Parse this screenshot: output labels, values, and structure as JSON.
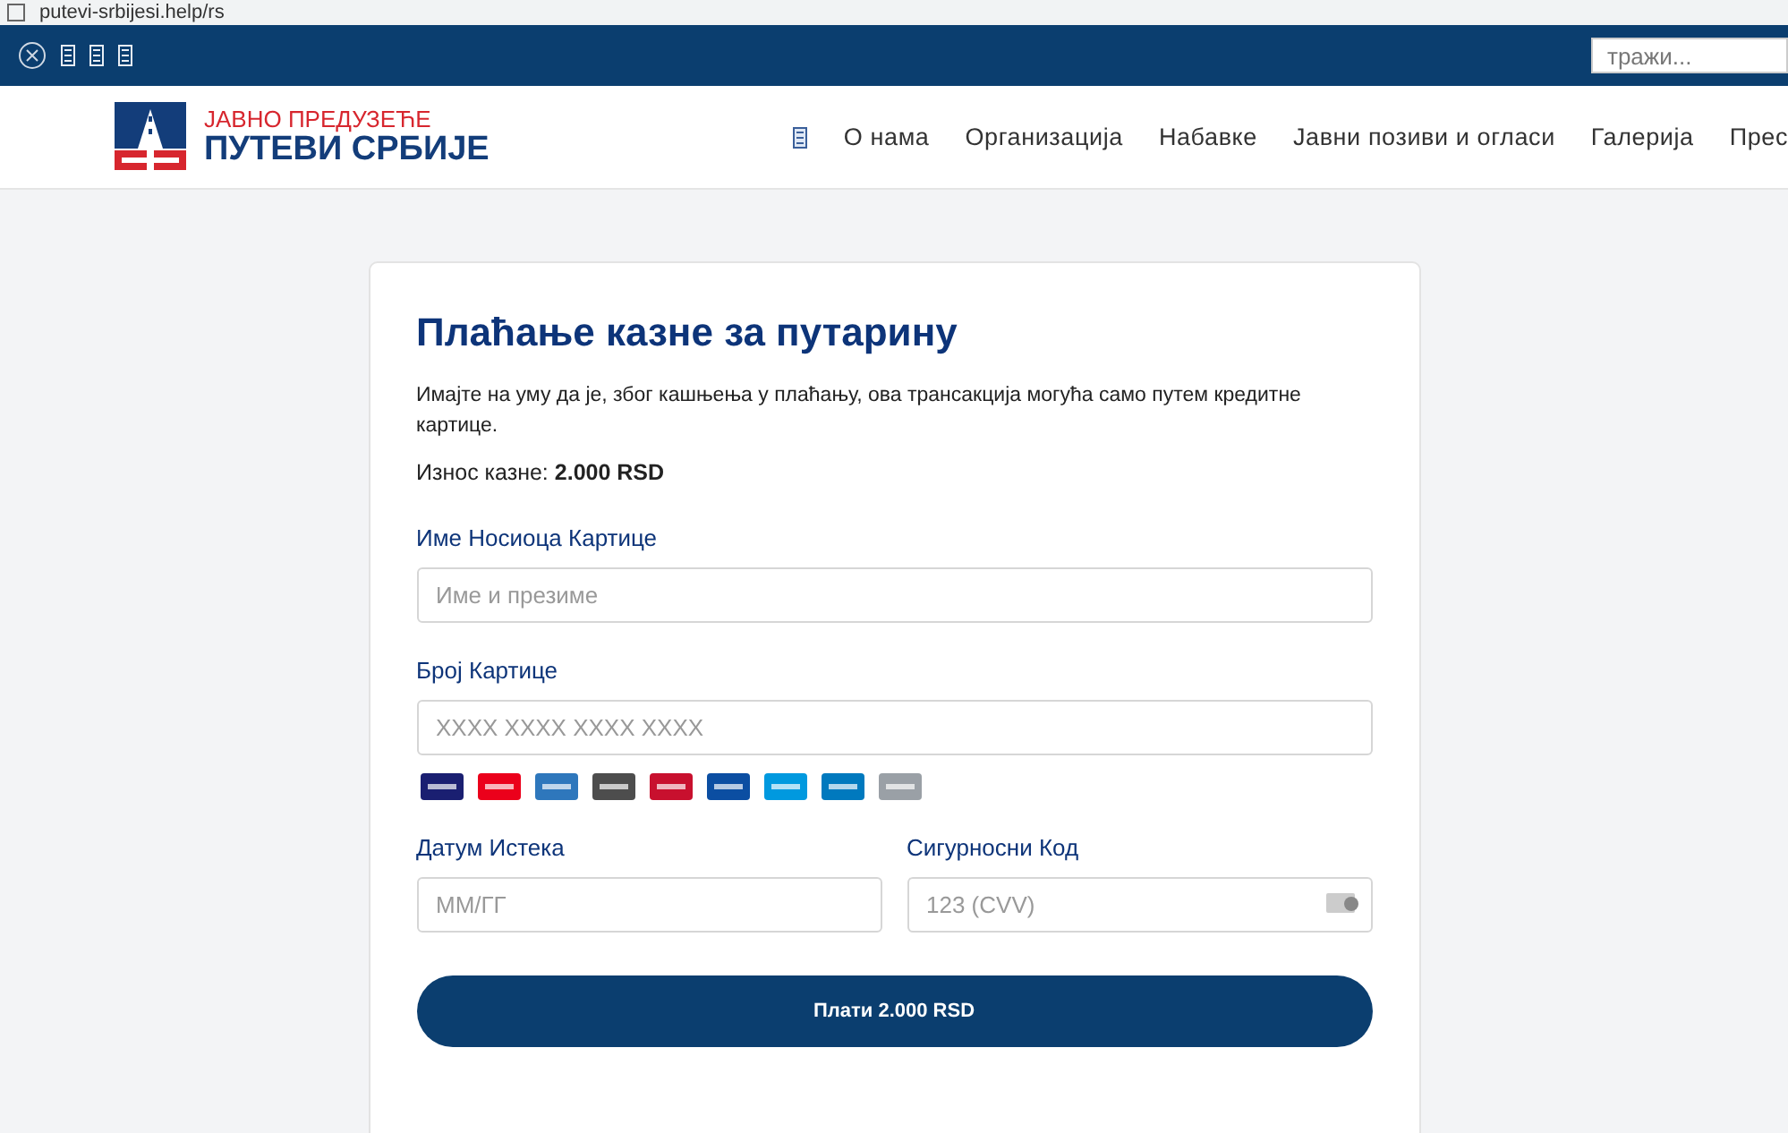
{
  "browser": {
    "url": "putevi-srbijesi.help/rs"
  },
  "topbar": {
    "search": {
      "placeholder": "тражи..."
    }
  },
  "header": {
    "logo": {
      "line1": "ЈАВНО ПРЕДУЗЕЋЕ",
      "line2": "ПУТЕВИ СРБИЈЕ"
    },
    "nav": [
      {
        "label": "О нама"
      },
      {
        "label": "Организација"
      },
      {
        "label": "Набавке"
      },
      {
        "label": "Јавни позиви и огласи"
      },
      {
        "label": "Галерија"
      },
      {
        "label": "Прес"
      }
    ]
  },
  "form": {
    "title": "Плаћање казне за путарину",
    "notice": "Имајте на уму да је, због кашњења у плаћању, ова трансакција могућа само путем кредитне картице.",
    "amount": "Износ казне: **2.000 RSD**",
    "fields": [
      {
        "label": "Име Носиоца Картице",
        "placeholder": "Име и презиме"
      },
      {
        "label": "Број Картице",
        "placeholder": "XXXX XXXX XXXX XXXX"
      }
    ],
    "card_logos": [
      {
        "color": "#1a1f71"
      },
      {
        "color": "#eb001b"
      },
      {
        "color": "#2e77bc"
      },
      {
        "color": "#4d4d4d"
      },
      {
        "color": "#c8102e"
      },
      {
        "color": "#0b4ea2"
      },
      {
        "color": "#0099df"
      },
      {
        "color": "#0079be"
      },
      {
        "color": "#9aa0a6"
      }
    ],
    "row_fields": [
      {
        "label": "Датум Истека",
        "placeholder": "ММ/ГГ"
      },
      {
        "label": "Сигурносни Код",
        "placeholder": "123 (CVV)"
      }
    ],
    "submit": "Плати 2.000 RSD"
  }
}
